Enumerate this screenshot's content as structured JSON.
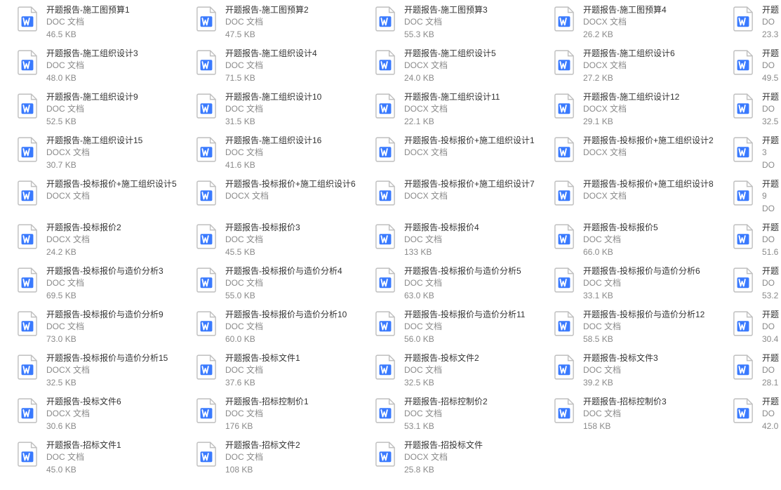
{
  "icon": {
    "name": "word-doc-icon"
  },
  "files": [
    [
      {
        "name": "开题报告-施工图预算1",
        "type": "DOC 文档",
        "size": "46.5 KB"
      },
      {
        "name": "开题报告-施工图预算2",
        "type": "DOC 文档",
        "size": "47.5 KB"
      },
      {
        "name": "开题报告-施工图预算3",
        "type": "DOC 文档",
        "size": "55.3 KB"
      },
      {
        "name": "开题报告-施工图预算4",
        "type": "DOCX 文档",
        "size": "26.2 KB"
      },
      {
        "name": "开题",
        "type": "DO",
        "size": "23.3"
      }
    ],
    [
      {
        "name": "开题报告-施工组织设计3",
        "type": "DOC 文档",
        "size": "48.0 KB"
      },
      {
        "name": "开题报告-施工组织设计4",
        "type": "DOC 文档",
        "size": "71.5 KB"
      },
      {
        "name": "开题报告-施工组织设计5",
        "type": "DOCX 文档",
        "size": "24.0 KB"
      },
      {
        "name": "开题报告-施工组织设计6",
        "type": "DOCX 文档",
        "size": "27.2 KB"
      },
      {
        "name": "开题",
        "type": "DO",
        "size": "49.5"
      }
    ],
    [
      {
        "name": "开题报告-施工组织设计9",
        "type": "DOC 文档",
        "size": "52.5 KB"
      },
      {
        "name": "开题报告-施工组织设计10",
        "type": "DOC 文档",
        "size": "31.5 KB"
      },
      {
        "name": "开题报告-施工组织设计11",
        "type": "DOCX 文档",
        "size": "22.1 KB"
      },
      {
        "name": "开题报告-施工组织设计12",
        "type": "DOCX 文档",
        "size": "29.1 KB"
      },
      {
        "name": "开题",
        "type": "DO",
        "size": "32.5"
      }
    ],
    [
      {
        "name": "开题报告-施工组织设计15",
        "type": "DOCX 文档",
        "size": "30.7 KB"
      },
      {
        "name": "开题报告-施工组织设计16",
        "type": "DOC 文档",
        "size": "41.6 KB"
      },
      {
        "name": "开题报告-投标报价+施工组织设计1",
        "type": "DOCX 文档",
        "size": "",
        "wrap": true
      },
      {
        "name": "开题报告-投标报价+施工组织设计2",
        "type": "DOCX 文档",
        "size": "",
        "wrap": true
      },
      {
        "name": "开题",
        "type": "3",
        "size": "DO"
      }
    ],
    [
      {
        "name": "开题报告-投标报价+施工组织设计5",
        "type": "DOCX 文档",
        "size": "",
        "wrap": true
      },
      {
        "name": "开题报告-投标报价+施工组织设计6",
        "type": "DOCX 文档",
        "size": "",
        "wrap": true
      },
      {
        "name": "开题报告-投标报价+施工组织设计7",
        "type": "DOCX 文档",
        "size": "",
        "wrap": true
      },
      {
        "name": "开题报告-投标报价+施工组织设计8",
        "type": "DOCX 文档",
        "size": "",
        "wrap": true
      },
      {
        "name": "开题",
        "type": "9",
        "size": "DO"
      }
    ],
    [
      {
        "name": "开题报告-投标报价2",
        "type": "DOCX 文档",
        "size": "24.2 KB"
      },
      {
        "name": "开题报告-投标报价3",
        "type": "DOC 文档",
        "size": "45.5 KB"
      },
      {
        "name": "开题报告-投标报价4",
        "type": "DOC 文档",
        "size": "133 KB"
      },
      {
        "name": "开题报告-投标报价5",
        "type": "DOC 文档",
        "size": "66.0 KB"
      },
      {
        "name": "开题",
        "type": "DO",
        "size": "51.6"
      }
    ],
    [
      {
        "name": "开题报告-投标报价与造价分析3",
        "type": "DOC 文档",
        "size": "69.5 KB"
      },
      {
        "name": "开题报告-投标报价与造价分析4",
        "type": "DOC 文档",
        "size": "55.0 KB"
      },
      {
        "name": "开题报告-投标报价与造价分析5",
        "type": "DOC 文档",
        "size": "63.0 KB"
      },
      {
        "name": "开题报告-投标报价与造价分析6",
        "type": "DOC 文档",
        "size": "33.1 KB"
      },
      {
        "name": "开题",
        "type": "DO",
        "size": "53.2"
      }
    ],
    [
      {
        "name": "开题报告-投标报价与造价分析9",
        "type": "DOC 文档",
        "size": "73.0 KB"
      },
      {
        "name": "开题报告-投标报价与造价分析10",
        "type": "DOC 文档",
        "size": "60.0 KB"
      },
      {
        "name": "开题报告-投标报价与造价分析11",
        "type": "DOC 文档",
        "size": "56.0 KB"
      },
      {
        "name": "开题报告-投标报价与造价分析12",
        "type": "DOC 文档",
        "size": "58.5 KB"
      },
      {
        "name": "开题",
        "type": "DO",
        "size": "30.4"
      }
    ],
    [
      {
        "name": "开题报告-投标报价与造价分析15",
        "type": "DOCX 文档",
        "size": "32.5 KB"
      },
      {
        "name": "开题报告-投标文件1",
        "type": "DOC 文档",
        "size": "37.6 KB"
      },
      {
        "name": "开题报告-投标文件2",
        "type": "DOC 文档",
        "size": "32.5 KB"
      },
      {
        "name": "开题报告-投标文件3",
        "type": "DOC 文档",
        "size": "39.2 KB"
      },
      {
        "name": "开题",
        "type": "DO",
        "size": "28.1"
      }
    ],
    [
      {
        "name": "开题报告-投标文件6",
        "type": "DOCX 文档",
        "size": "30.6 KB"
      },
      {
        "name": "开题报告-招标控制价1",
        "type": "DOC 文档",
        "size": "176 KB"
      },
      {
        "name": "开题报告-招标控制价2",
        "type": "DOC 文档",
        "size": "53.1 KB"
      },
      {
        "name": "开题报告-招标控制价3",
        "type": "DOC 文档",
        "size": "158 KB"
      },
      {
        "name": "开题",
        "type": "DO",
        "size": "42.0"
      }
    ],
    [
      {
        "name": "开题报告-招标文件1",
        "type": "DOC 文档",
        "size": "45.0 KB"
      },
      {
        "name": "开题报告-招标文件2",
        "type": "DOC 文档",
        "size": "108 KB"
      },
      {
        "name": "开题报告-招投标文件",
        "type": "DOCX 文档",
        "size": "25.8 KB"
      }
    ]
  ]
}
